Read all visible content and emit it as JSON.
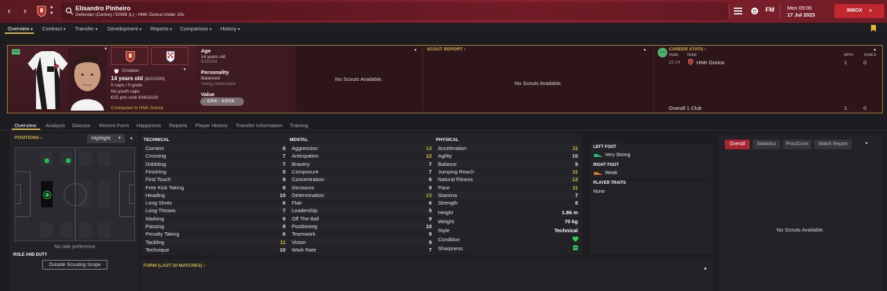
{
  "topbar": {
    "player_name": "Elisandro Pinheiro",
    "player_sub": "Defender (Centre) / D/WB (L) - HNK Gorica Under 19s",
    "fm_label": "FM",
    "date_day": "Mon 09:00",
    "date_full": "17 Jul 2023",
    "inbox_label": "INBOX",
    "inbox_chevron": "»"
  },
  "menu": [
    {
      "label": "Overview"
    },
    {
      "label": "Contract"
    },
    {
      "label": "Transfer"
    },
    {
      "label": "Development"
    },
    {
      "label": "Reports"
    },
    {
      "label": "Comparison"
    },
    {
      "label": "History"
    }
  ],
  "profile": {
    "nationality": "Croatian",
    "age_line": "14 years old",
    "dob_paren": "(9/2/2009)",
    "caps": "0 caps / 0 goals",
    "youth_caps": "No youth caps",
    "wage": "€25 p/m until 30/6/2029",
    "contract": "Contracted to HNK Gorica",
    "tag": "YTH"
  },
  "info": {
    "age_label": "Age",
    "age_value": "14 years old",
    "age_dob": "9/2/2009",
    "personality_label": "Personality",
    "personality_value": "Balanced",
    "personality_sub": "Young centre-back",
    "value_label": "Value",
    "value_range": "€35K - €350K"
  },
  "scouts": {
    "card1": "No Scouts Available.",
    "report_title": "SCOUT REPORT",
    "report_text": "No Scouts Available."
  },
  "career": {
    "title": "CAREER STATS",
    "col_year": "YEAR",
    "col_team": "TEAM",
    "col_apps": "APPS",
    "col_goals": "GOALS",
    "row_year": "22-24",
    "row_team": "HNK Gorica",
    "row_apps": "1",
    "row_goals": "0",
    "total_label": "Overall 1 Club",
    "total_apps": "1",
    "total_goals": "0"
  },
  "subtabs": [
    {
      "label": "Overview"
    },
    {
      "label": "Analysis"
    },
    {
      "label": "Discuss"
    },
    {
      "label": "Recent Form"
    },
    {
      "label": "Happiness"
    },
    {
      "label": "Reports"
    },
    {
      "label": "Player History"
    },
    {
      "label": "Transfer Information"
    },
    {
      "label": "Training"
    }
  ],
  "positions": {
    "title": "POSITIONS",
    "dropdown": "Highlight",
    "side_pref": "No side preference",
    "role_title": "ROLE AND DUTY",
    "scope_button": "Outside Scouting Scope"
  },
  "technical": {
    "title": "TECHNICAL",
    "rows": [
      {
        "name": "Corners",
        "value": "6"
      },
      {
        "name": "Crossing",
        "value": "7"
      },
      {
        "name": "Dribbling",
        "value": "7"
      },
      {
        "name": "Finishing",
        "value": "5"
      },
      {
        "name": "First Touch",
        "value": "9"
      },
      {
        "name": "Free Kick Taking",
        "value": "8"
      },
      {
        "name": "Heading",
        "value": "10"
      },
      {
        "name": "Long Shots",
        "value": "6"
      },
      {
        "name": "Long Throws",
        "value": "7"
      },
      {
        "name": "Marking",
        "value": "9"
      },
      {
        "name": "Passing",
        "value": "9"
      },
      {
        "name": "Penalty Taking",
        "value": "6"
      },
      {
        "name": "Tackling",
        "value": "11"
      },
      {
        "name": "Technique",
        "value": "10"
      }
    ]
  },
  "mental": {
    "title": "MENTAL",
    "rows": [
      {
        "name": "Aggression",
        "value": "13"
      },
      {
        "name": "Anticipation",
        "value": "12"
      },
      {
        "name": "Bravery",
        "value": "7"
      },
      {
        "name": "Composure",
        "value": "7"
      },
      {
        "name": "Concentration",
        "value": "6"
      },
      {
        "name": "Decisions",
        "value": "8"
      },
      {
        "name": "Determination",
        "value": "13"
      },
      {
        "name": "Flair",
        "value": "6"
      },
      {
        "name": "Leadership",
        "value": "5"
      },
      {
        "name": "Off The Ball",
        "value": "9"
      },
      {
        "name": "Positioning",
        "value": "10"
      },
      {
        "name": "Teamwork",
        "value": "8"
      },
      {
        "name": "Vision",
        "value": "9"
      },
      {
        "name": "Work Rate",
        "value": "7"
      }
    ]
  },
  "physical": {
    "title": "PHYSICAL",
    "rows": [
      {
        "name": "Acceleration",
        "value": "11"
      },
      {
        "name": "Agility",
        "value": "10"
      },
      {
        "name": "Balance",
        "value": "9"
      },
      {
        "name": "Jumping Reach",
        "value": "11"
      },
      {
        "name": "Natural Fitness",
        "value": "12"
      },
      {
        "name": "Pace",
        "value": "11"
      },
      {
        "name": "Stamina",
        "value": "7"
      },
      {
        "name": "Strength",
        "value": "8"
      }
    ],
    "height_label": "Height",
    "height_value": "1.86 m",
    "weight_label": "Weight",
    "weight_value": "70 kg",
    "style_label": "Style",
    "style_value": "Technical",
    "condition_label": "Condition",
    "sharpness_label": "Sharpness"
  },
  "feet": {
    "left_title": "LEFT FOOT",
    "left_value": "Very Strong",
    "right_title": "RIGHT FOOT",
    "right_value": "Weak",
    "traits_title": "PLAYER TRAITS",
    "traits_value": "None"
  },
  "form": {
    "title": "FORM (LAST 20 MATCHES)"
  },
  "right": {
    "tabs": [
      {
        "label": "Overall"
      },
      {
        "label": "Statistics"
      },
      {
        "label": "Pros/Cons"
      },
      {
        "label": "Match Report"
      }
    ],
    "empty": "No Scouts Available."
  },
  "colors": {
    "accent": "#d8b84a",
    "inbox": "#c1272d",
    "good_green": "#21c24a"
  }
}
